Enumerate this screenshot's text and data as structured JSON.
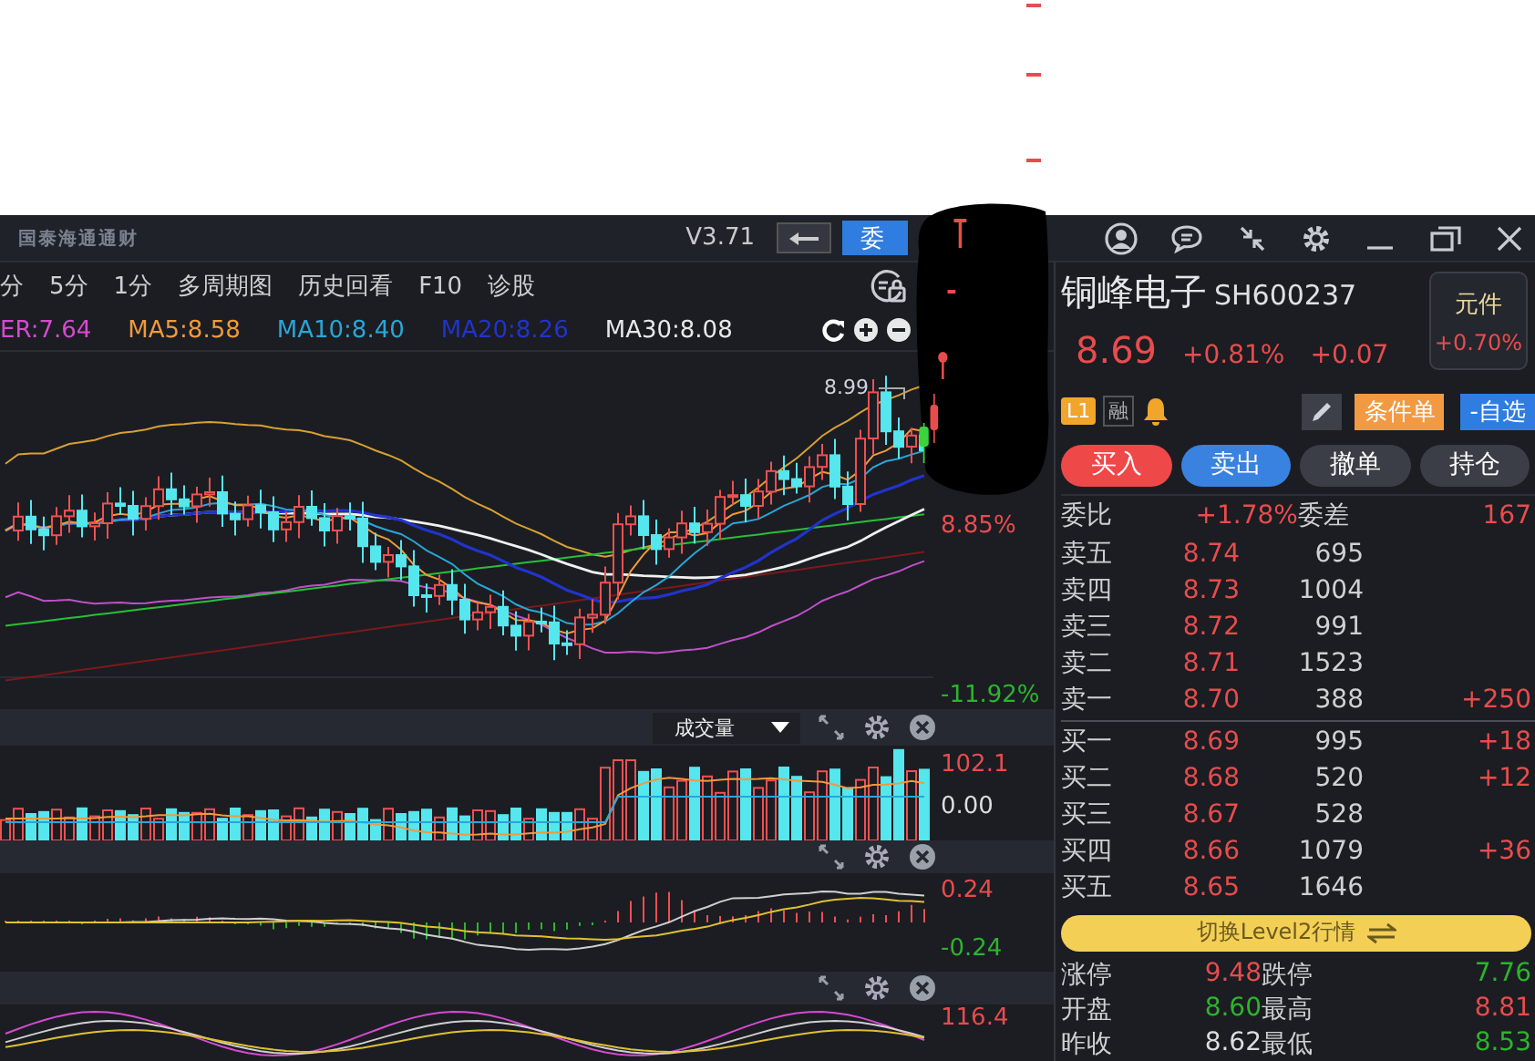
{
  "title_bar": {
    "logo": "国泰海通通财",
    "version": "V3.71",
    "order_button": "委"
  },
  "chart_toolbar": {
    "tabs": [
      {
        "label": "分",
        "selected": false
      },
      {
        "label": "5分",
        "selected": false
      },
      {
        "label": "1分",
        "selected": false
      },
      {
        "label": "多周期图",
        "selected": false
      },
      {
        "label": "历史回看",
        "selected": false
      },
      {
        "label": "F10",
        "selected": false
      },
      {
        "label": "诊股",
        "selected": false
      }
    ]
  },
  "ma_legend": [
    {
      "label": "ER:7.64",
      "color": "#d64ad0"
    },
    {
      "label": "MA5:8.58",
      "color": "#f09a3a"
    },
    {
      "label": "MA10:8.40",
      "color": "#2aa6d6"
    },
    {
      "label": "MA20:8.26",
      "color": "#2233cc"
    },
    {
      "label": "MA30:8.08",
      "color": "#e8e8e8"
    }
  ],
  "main_chart": {
    "high_label": "8.99",
    "axis_labels": [
      {
        "text": "8.85%",
        "kind": "up"
      },
      {
        "text": "-11.92%",
        "kind": "down"
      }
    ]
  },
  "volume_panel": {
    "indicator": "成交量",
    "axis_labels": [
      {
        "text": "102.1",
        "kind": "up"
      },
      {
        "text": "0.00",
        "kind": "flat"
      }
    ]
  },
  "macd_panel": {
    "axis_labels": [
      {
        "text": "0.24",
        "kind": "up"
      },
      {
        "text": "-0.24",
        "kind": "down"
      }
    ]
  },
  "kdj_panel": {
    "axis_labels": [
      {
        "text": "116.4",
        "kind": "up"
      }
    ]
  },
  "quote": {
    "name": "铜峰电子",
    "code": "SH600237",
    "price": "8.69",
    "change_pct": "+0.81%",
    "change": "+0.07",
    "sector": {
      "name": "元件",
      "change": "+0.70%"
    }
  },
  "tags": {
    "level": "L1",
    "margin": "融"
  },
  "actions": {
    "condition_order": "条件单",
    "watchlist": "-自选"
  },
  "trade_buttons": [
    {
      "label": "买入",
      "kind": "buy"
    },
    {
      "label": "卖出",
      "kind": "sell"
    },
    {
      "label": "撤单",
      "kind": "plain"
    },
    {
      "label": "持仓",
      "kind": "plain"
    }
  ],
  "order_book": {
    "ratio_label": "委比",
    "ratio": "+1.78%",
    "diff_label": "委差",
    "diff": "167",
    "asks": [
      {
        "label": "卖五",
        "price": "8.74",
        "volume": "695"
      },
      {
        "label": "卖四",
        "price": "8.73",
        "volume": "1004"
      },
      {
        "label": "卖三",
        "price": "8.72",
        "volume": "991"
      },
      {
        "label": "卖二",
        "price": "8.71",
        "volume": "1523"
      },
      {
        "label": "卖一",
        "price": "8.70",
        "volume": "388",
        "change": "+250"
      }
    ],
    "bids": [
      {
        "label": "买一",
        "price": "8.69",
        "volume": "995",
        "change": "+18"
      },
      {
        "label": "买二",
        "price": "8.68",
        "volume": "520",
        "change": "+12"
      },
      {
        "label": "买三",
        "price": "8.67",
        "volume": "528"
      },
      {
        "label": "买四",
        "price": "8.66",
        "volume": "1079",
        "change": "+36"
      },
      {
        "label": "买五",
        "price": "8.65",
        "volume": "1646"
      }
    ]
  },
  "level2_button": "切换Level2行情",
  "stats": [
    {
      "label": "涨停",
      "value": "9.48",
      "kind": "up"
    },
    {
      "label": "跌停",
      "value": "7.76",
      "kind": "down"
    },
    {
      "label": "开盘",
      "value": "8.60",
      "kind": "down"
    },
    {
      "label": "最高",
      "value": "8.81",
      "kind": "up"
    },
    {
      "label": "昨收",
      "value": "8.62",
      "kind": "flat"
    },
    {
      "label": "最低",
      "value": "8.53",
      "kind": "down"
    }
  ]
}
